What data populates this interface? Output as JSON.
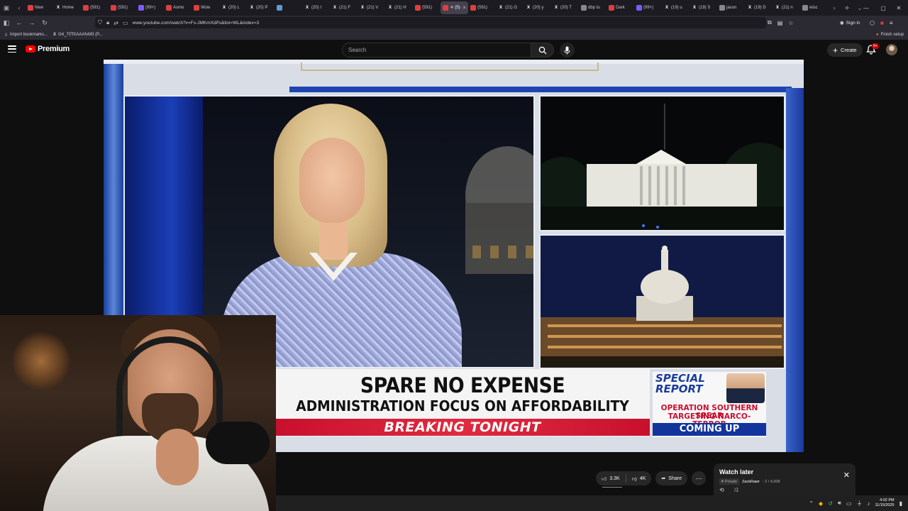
{
  "browser": {
    "tabs": [
      {
        "label": "New",
        "color": "#e03e3e",
        "icon": "youtube-icon"
      },
      {
        "label": "Home",
        "color": "#000000",
        "icon": "x-icon"
      },
      {
        "label": "(591)",
        "color": "#e03e3e",
        "icon": "youtube-icon"
      },
      {
        "label": "(591)",
        "color": "#e03e3e",
        "icon": "youtube-icon"
      },
      {
        "label": "(99+)",
        "color": "#7b5cff",
        "icon": "app-icon"
      },
      {
        "label": "Asmo",
        "color": "#e03e3e",
        "icon": "youtube-icon"
      },
      {
        "label": "Wow",
        "color": "#e03e3e",
        "icon": "youtube-icon"
      },
      {
        "label": "(20) L",
        "color": "#000000",
        "icon": "x-icon"
      },
      {
        "label": "(20) P",
        "color": "#000000",
        "icon": "x-icon"
      },
      {
        "label": "",
        "color": "#5b9bd5",
        "icon": "page-icon"
      },
      {
        "label": "(20) I",
        "color": "#000000",
        "icon": "x-icon"
      },
      {
        "label": "(21) F",
        "color": "#000000",
        "icon": "x-icon"
      },
      {
        "label": "(21) V",
        "color": "#000000",
        "icon": "x-icon"
      },
      {
        "label": "(21) H",
        "color": "#000000",
        "icon": "x-icon"
      },
      {
        "label": "(591)",
        "color": "#e03e3e",
        "icon": "youtube-icon"
      },
      {
        "label": "(5)",
        "color": "#e03e3e",
        "icon": "youtube-icon",
        "active": true
      },
      {
        "label": "(591)",
        "color": "#e03e3e",
        "icon": "youtube-icon"
      },
      {
        "label": "(21) G",
        "color": "#000000",
        "icon": "x-icon"
      },
      {
        "label": "(20) y",
        "color": "#000000",
        "icon": "x-icon"
      },
      {
        "label": "(20) T",
        "color": "#000000",
        "icon": "x-icon"
      },
      {
        "label": "dbp tu",
        "color": "#888888",
        "icon": "globe-icon"
      },
      {
        "label": "Dark",
        "color": "#e03e3e",
        "icon": "youtube-icon"
      },
      {
        "label": "(99+)",
        "color": "#7b5cff",
        "icon": "app-icon"
      },
      {
        "label": "(19) u",
        "color": "#000000",
        "icon": "x-icon"
      },
      {
        "label": "(19) S",
        "color": "#000000",
        "icon": "x-icon"
      },
      {
        "label": "jason",
        "color": "#888888",
        "icon": "globe-icon"
      },
      {
        "label": "(19) D",
        "color": "#000000",
        "icon": "x-icon"
      },
      {
        "label": "(21) n",
        "color": "#000000",
        "icon": "x-icon"
      },
      {
        "label": "wisc",
        "color": "#888888",
        "icon": "globe-icon"
      }
    ],
    "url": "www.youtube.com/watch?v=Fs-JMKmXdPs&list=WL&index=3",
    "sign_in": "Sign in",
    "bookmarks": [
      {
        "label": "Import bookmarks...",
        "icon": "import-icon"
      },
      {
        "label": "G4_7t7fXAAAfvM3 (P...",
        "icon": "x-icon"
      }
    ],
    "finish_setup": "Finish setup"
  },
  "youtube": {
    "logo_text": "Premium",
    "search_placeholder": "Search",
    "create_label": "Create",
    "notifications_badge": "9+",
    "actions": {
      "likes": "3.3K",
      "dislikes": "4K",
      "share": "Share"
    },
    "watch_later": {
      "title": "Watch later",
      "privacy": "Private",
      "owner": "ZackRawr",
      "position": "- 2 / 4,908"
    }
  },
  "video": {
    "chyron_line1": "SPARE NO EXPENSE",
    "chyron_line2": "ADMINISTRATION FOCUS ON AFFORDABILITY",
    "breaking": "BREAKING TONIGHT",
    "special_title": "SPECIAL REPORT",
    "operation_line1": "OPERATION SOUTHERN SPEAR",
    "operation_line2": "TARGETING NARCO-TERROR",
    "coming_up": "COMING UP"
  },
  "taskbar": {
    "time": "4:02 PM",
    "date": "11/15/2025"
  }
}
